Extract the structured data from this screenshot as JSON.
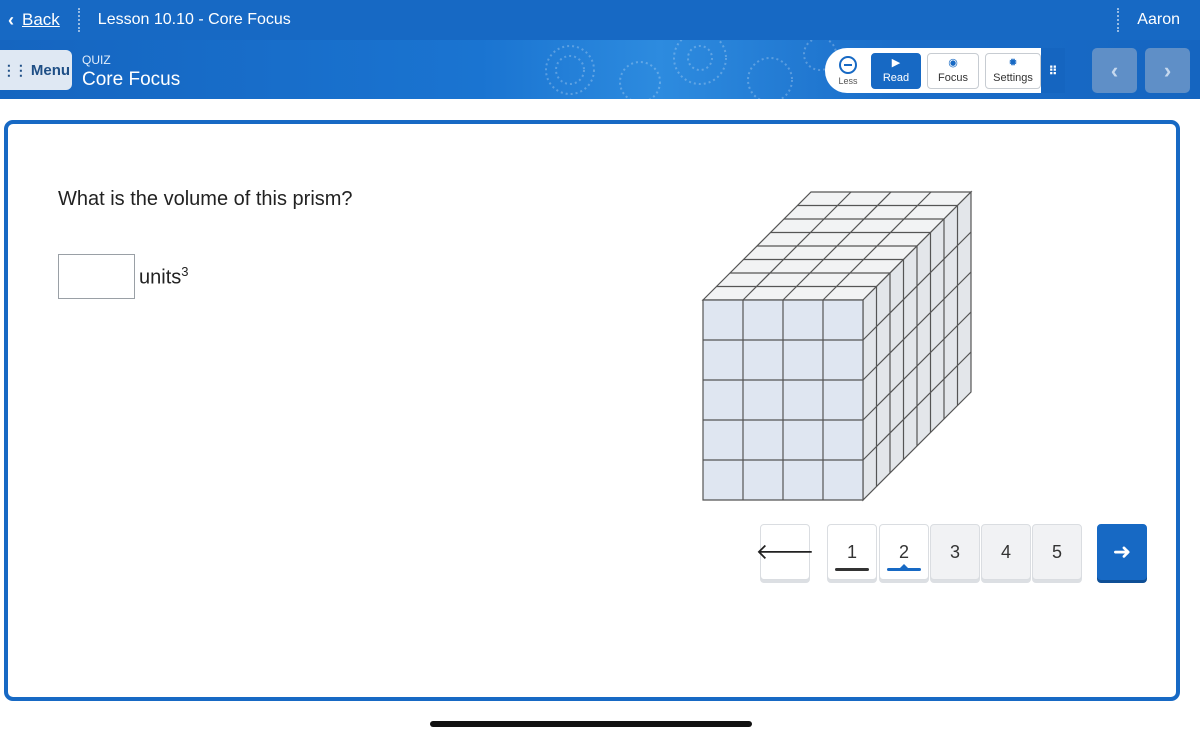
{
  "topbar": {
    "back_label": "Back",
    "lesson_title": "Lesson 10.10 - Core Focus",
    "user_name": "Aaron"
  },
  "header": {
    "menu_label": "Menu",
    "section_label": "QUIZ",
    "title": "Core Focus"
  },
  "toolbar": {
    "less_label": "Less",
    "read_label": "Read",
    "focus_label": "Focus",
    "settings_label": "Settings",
    "icons": {
      "less": "minus-circle-icon",
      "read": "play-icon",
      "focus": "eye-icon",
      "settings": "gear-icon",
      "grip": "grip-dots-icon"
    }
  },
  "nav": {
    "prev_icon": "chevron-left-icon",
    "next_icon": "chevron-right-icon"
  },
  "question": {
    "prompt": "What is the volume of this prism?",
    "answer_value": "",
    "units_base": "units",
    "units_exponent": "3"
  },
  "prism_figure": {
    "front_columns": 4,
    "front_rows": 5,
    "depth": 8
  },
  "pager": {
    "prev_icon": "arrow-left-icon",
    "next_icon": "arrow-right-icon",
    "pages": [
      "1",
      "2",
      "3",
      "4",
      "5"
    ],
    "current_page": "2"
  },
  "colors": {
    "brand_blue": "#1769c4",
    "cube_face": "#dfe6f1",
    "cube_top": "#f2f3f4",
    "cube_side": "#e3e6ea",
    "cube_edge": "#555555"
  }
}
